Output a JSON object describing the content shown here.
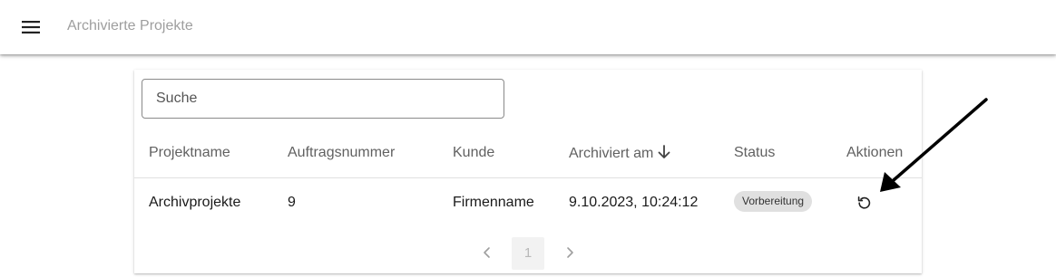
{
  "appbar": {
    "menu_icon": "menu-icon",
    "title": "Archivierte Projekte"
  },
  "search": {
    "placeholder": "Suche",
    "value": ""
  },
  "table": {
    "columns": {
      "name": "Projektname",
      "order": "Auftragsnummer",
      "customer": "Kunde",
      "archived": "Archiviert am",
      "status": "Status",
      "actions": "Aktionen"
    },
    "sort": {
      "column": "archived",
      "direction": "descending",
      "icon": "arrow-down-icon"
    },
    "rows": [
      {
        "name": "Archivprojekte",
        "order": "9",
        "customer": "Firmenname",
        "archived": "9.10.2023, 10:24:12",
        "status": "Vorbereitung",
        "action_icon": "restore-icon"
      }
    ]
  },
  "pagination": {
    "current_page": "1",
    "prev_icon": "chevron-left-icon",
    "next_icon": "chevron-right-icon"
  },
  "annotation": {
    "icon": "arrow-icon",
    "color": "#000000"
  }
}
